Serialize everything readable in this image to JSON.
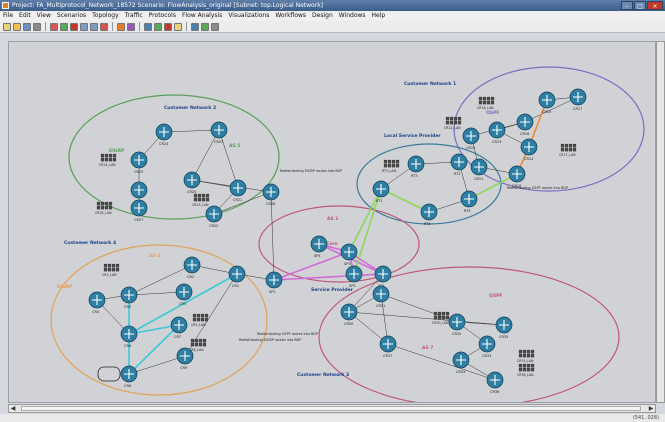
{
  "window": {
    "title": "Project: FA_Multiprotocol_Network_18572 Scenario: FlowAnalysis_original  [Subnet: top.Logical Network]"
  },
  "window_controls": [
    "–",
    "□",
    "×"
  ],
  "menu": [
    "File",
    "Edit",
    "View",
    "Scenarios",
    "Topology",
    "Traffic",
    "Protocols",
    "Flow Analysis",
    "Visualizations",
    "Workflows",
    "Design",
    "Windows",
    "Help"
  ],
  "toolbar_icons": [
    "new-icon",
    "open-icon",
    "save-icon",
    "print-icon",
    "sep",
    "node-icon",
    "link-icon",
    "zoom-in-icon",
    "zoom-out-icon",
    "flag-icon",
    "filter-icon",
    "sep",
    "chart-icon",
    "table-icon",
    "sep",
    "route-icon",
    "report-icon",
    "map-icon",
    "help-icon",
    "sep",
    "grid-icon",
    "window-icon",
    "tile-icon"
  ],
  "toolbar_colors": [
    "#e8d27a",
    "#f3c14b",
    "#6b8fc6",
    "#8a8a8a",
    "#d9534f",
    "#5aa85a",
    "#c0392b",
    "#7a9cc6",
    "#7a9cc6",
    "#d9534f",
    "#e67e22",
    "#9b59b6",
    "#4a7fb0",
    "#5aa85a",
    "#c0392b",
    "#e8d27a",
    "#4a7fb0",
    "#5aa85a",
    "#8a8a8a",
    "#8a8a8a",
    "#8a8a8a"
  ],
  "status": {
    "coords": "(541, 028)"
  },
  "scroll": {
    "left_arrow": "◀",
    "right_arrow": "▶"
  },
  "colors": {
    "router": "#2e7fa3",
    "lan": "#4b4b4b",
    "green_zone": "#5aa05a",
    "purple_zone": "#7a6ec2",
    "orange_zone": "#e3a15a",
    "red_zone": "#c0567a",
    "blue_zone": "#3a7a9a"
  },
  "zones": [
    {
      "id": "cn2",
      "label": "Customer Network 2",
      "sub": "EIGRP",
      "as": "AS 5",
      "color": "#5aa05a"
    },
    {
      "id": "cn1",
      "label": "Customer Network 1",
      "sub": "OSPF",
      "as": "",
      "color": "#7a6ec2"
    },
    {
      "id": "lsp",
      "label": "Local Service Provider",
      "sub": "",
      "as": "",
      "color": "#3a7a9a"
    },
    {
      "id": "sp",
      "label": "Service Provider",
      "sub": "BGP Core",
      "as": "AS 1",
      "color": "#c0567a"
    },
    {
      "id": "cn4",
      "label": "Customer Network 4",
      "sub": "EIGRP",
      "as": "AS 4",
      "color": "#e3a15a"
    },
    {
      "id": "cn3",
      "label": "Customer Network 3",
      "sub": "OSPF",
      "as": "AS 7",
      "color": "#c0567a"
    }
  ],
  "annotations": [
    "Redistributing EIGRP routes into BGP",
    "Redistributing OSPF routes into BGP",
    "Redistributing EIGRP routes into BGP",
    "Redistributing OSPF routes into BGP",
    "Redistributing BGP routes into OSPF"
  ],
  "routers": [
    {
      "name": "CR24"
    },
    {
      "name": "CR23"
    },
    {
      "name": "CR25"
    },
    {
      "name": "CR26"
    },
    {
      "name": "CR27"
    },
    {
      "name": "CR20"
    },
    {
      "name": "CR21"
    },
    {
      "name": "CR22"
    },
    {
      "name": "CR28"
    },
    {
      "name": "CR16"
    },
    {
      "name": "CR12"
    },
    {
      "name": "CR13"
    },
    {
      "name": "CR17"
    },
    {
      "name": "CR11"
    },
    {
      "name": "CR14"
    },
    {
      "name": "CR10"
    },
    {
      "name": "CR15"
    },
    {
      "name": "RT1"
    },
    {
      "name": "RT3"
    },
    {
      "name": "RT2"
    },
    {
      "name": "RT4"
    },
    {
      "name": "RT5"
    },
    {
      "name": "SP1"
    },
    {
      "name": "SP2"
    },
    {
      "name": "SP3"
    },
    {
      "name": "SP4"
    },
    {
      "name": "SP5"
    },
    {
      "name": "CR1"
    },
    {
      "name": "CR2"
    },
    {
      "name": "CR3"
    },
    {
      "name": "CR4"
    },
    {
      "name": "CR5"
    },
    {
      "name": "CR6"
    },
    {
      "name": "CR7"
    },
    {
      "name": "CR8"
    },
    {
      "name": "CR9"
    },
    {
      "name": "CR30"
    },
    {
      "name": "CR31"
    },
    {
      "name": "CR32"
    },
    {
      "name": "CR33"
    },
    {
      "name": "CR34"
    },
    {
      "name": "CR35"
    },
    {
      "name": "CR36"
    },
    {
      "name": "CR37"
    }
  ],
  "lans": [
    {
      "name": "CR24_LAN"
    },
    {
      "name": "CR25_LAN"
    },
    {
      "name": "CR23_LAN"
    },
    {
      "name": "CR16_LAN"
    },
    {
      "name": "CR17_LAN"
    },
    {
      "name": "CR12_LAN"
    },
    {
      "name": "RT3_LAN"
    },
    {
      "name": "CR3_LAN"
    },
    {
      "name": "CR5_LAN"
    },
    {
      "name": "CR6_LAN"
    },
    {
      "name": "CR30_LAN"
    },
    {
      "name": "CR33_LAN"
    },
    {
      "name": "CR36_LAN"
    }
  ]
}
